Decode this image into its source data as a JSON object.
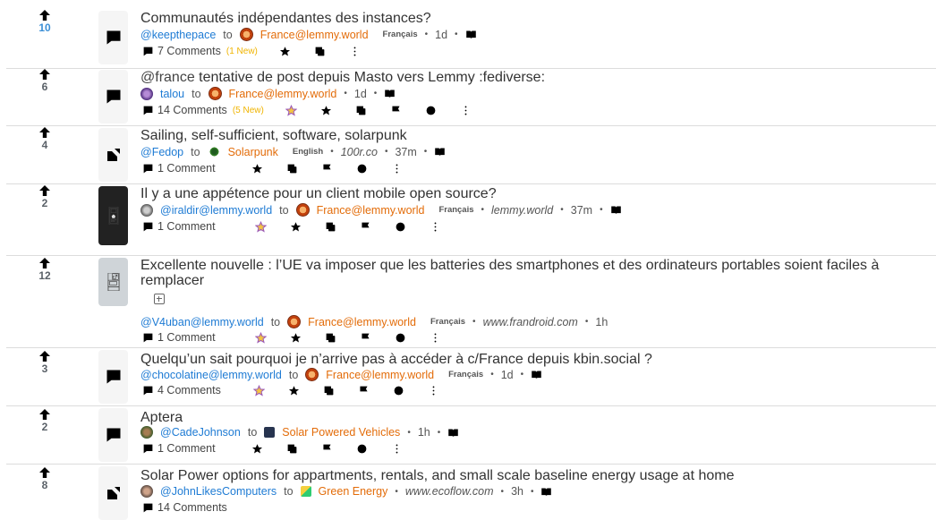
{
  "posts": [
    {
      "score": "10",
      "title": "Communautés indépendantes des instances?",
      "user": "@keepthepace",
      "to": "to",
      "community": "France@lemmy.world",
      "lang": "Français",
      "time": "1d",
      "comments": "7 Comments",
      "new": "(1 New)"
    },
    {
      "score": "6",
      "mention": "@france",
      "title": " tentative de post depuis Masto vers Lemmy :fediverse:",
      "user": "talou",
      "to": "to",
      "community": "France@lemmy.world",
      "time": "1d",
      "comments": "14 Comments",
      "new": "(5 New)"
    },
    {
      "score": "4",
      "title": "Sailing, self-sufficient, software, solarpunk",
      "user": "@Fedop",
      "to": "to",
      "community": "Solarpunk",
      "lang": "English",
      "domain": "100r.co",
      "time": "37m",
      "comments": "1 Comment"
    },
    {
      "score": "2",
      "title": "Il y a une appétence pour un client mobile open source?",
      "user": "@iraldir@lemmy.world",
      "to": "to",
      "community": "France@lemmy.world",
      "lang": "Français",
      "domain": "lemmy.world",
      "time": "37m",
      "comments": "1 Comment"
    },
    {
      "score": "12",
      "title_line1": "Excellente nouvelle : l’UE va imposer que les batteries des smartphones et des ordinateurs portables soient faciles à",
      "title_line2": "remplacer",
      "user": "@V4uban@lemmy.world",
      "to": "to",
      "community": "France@lemmy.world",
      "lang": "Français",
      "domain": "www.frandroid.com",
      "time": "1h",
      "comments": "1 Comment"
    },
    {
      "score": "3",
      "title": "Quelqu’un sait pourquoi je n’arrive pas à accéder à c/France depuis kbin.social ?",
      "user": "@chocolatine@lemmy.world",
      "to": "to",
      "community": "France@lemmy.world",
      "lang": "Français",
      "time": "1d",
      "comments": "4 Comments"
    },
    {
      "score": "2",
      "title": "Aptera",
      "user": "@CadeJohnson",
      "to": "to",
      "community": "Solar Powered Vehicles",
      "time": "1h",
      "comments": "1 Comment"
    },
    {
      "score": "8",
      "title": "Solar Power options for appartments, rentals, and small scale baseline energy usage at home",
      "user": "@JohnLikesComputers",
      "to": "to",
      "community": "Green Energy",
      "domain": "www.ecoflow.com",
      "time": "3h",
      "comments": "14 Comments"
    }
  ],
  "separator": "•",
  "colors": {
    "upvoted": "#3b8fd6",
    "user": "#1e7bd4",
    "community": "#e36c09",
    "new": "#f0b400"
  }
}
